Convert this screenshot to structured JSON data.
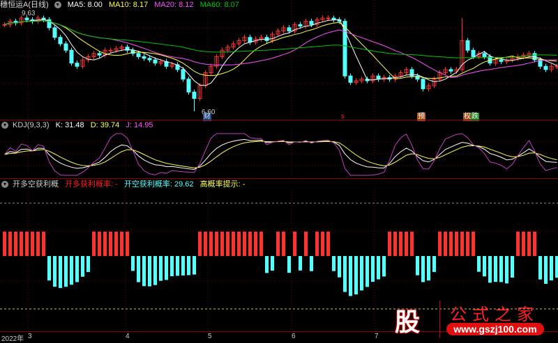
{
  "main": {
    "title": "穗恒运A(日线)",
    "ma5": "MA5: 8.00",
    "ma10": "MA10: 8.17",
    "ma20": "MA20: 8.12",
    "ma60": "MA60: 8.07",
    "high_label": "9.63",
    "low_label": "6.60",
    "closes": [
      9.3,
      9.4,
      9.35,
      9.5,
      9.45,
      9.4,
      9.5,
      9.45,
      9.2,
      8.9,
      8.7,
      8.5,
      8.1,
      8.0,
      8.2,
      8.3,
      8.4,
      8.35,
      8.5,
      8.5,
      8.55,
      8.6,
      8.5,
      8.4,
      8.3,
      8.25,
      8.2,
      8.1,
      8.15,
      8.0,
      8.05,
      7.9,
      7.6,
      7.2,
      7.0,
      7.4,
      7.8,
      8.0,
      8.3,
      8.5,
      8.6,
      8.7,
      8.8,
      8.9,
      8.75,
      8.85,
      8.9,
      8.8,
      9.0,
      9.1,
      9.2,
      9.1,
      9.3,
      9.25,
      9.4,
      9.3,
      9.45,
      9.5,
      9.5,
      9.45,
      9.4,
      7.7,
      7.5,
      7.55,
      7.6,
      7.55,
      7.7,
      7.6,
      7.65,
      7.6,
      7.7,
      7.8,
      7.9,
      7.7,
      7.6,
      7.3,
      7.4,
      7.6,
      7.8,
      7.9,
      7.85,
      7.9,
      8.8,
      8.5,
      8.3,
      8.4,
      8.3,
      8.1,
      8.2,
      8.15,
      8.2,
      8.25,
      8.3,
      8.35,
      8.4,
      8.2,
      8.0,
      7.9,
      8.0,
      8.0
    ],
    "colors": {
      "up": "#ff3232",
      "down": "#54ffff",
      "ma5": "#ffffff",
      "ma10": "#ffff50",
      "ma20": "#ff50ff",
      "ma60": "#00c800"
    },
    "markers": [
      {
        "text": "财",
        "color": "#3a7ac8"
      },
      {
        "text": "s",
        "color": "#ff2020"
      },
      {
        "text": "预",
        "color": "#c86428"
      },
      {
        "text": "权",
        "color": "#c86428"
      },
      {
        "text": "跌",
        "color": "#2a9a2a"
      }
    ]
  },
  "kdj": {
    "title": "KDJ(9,3,3)",
    "k": "K: 31.48",
    "d": "D: 39.74",
    "j": "J: 14.95"
  },
  "ind": {
    "title": "开多空获利概",
    "long": "开多获利概率: -",
    "short": "开空获利概率: 29.62",
    "hint": "高概率提示: -"
  },
  "axis": {
    "year": "2022年",
    "months": [
      "3",
      "4",
      "5",
      "6",
      "7"
    ]
  },
  "logo": {
    "char": "股",
    "name": "公式之家",
    "url": "www.gszj100.com"
  }
}
